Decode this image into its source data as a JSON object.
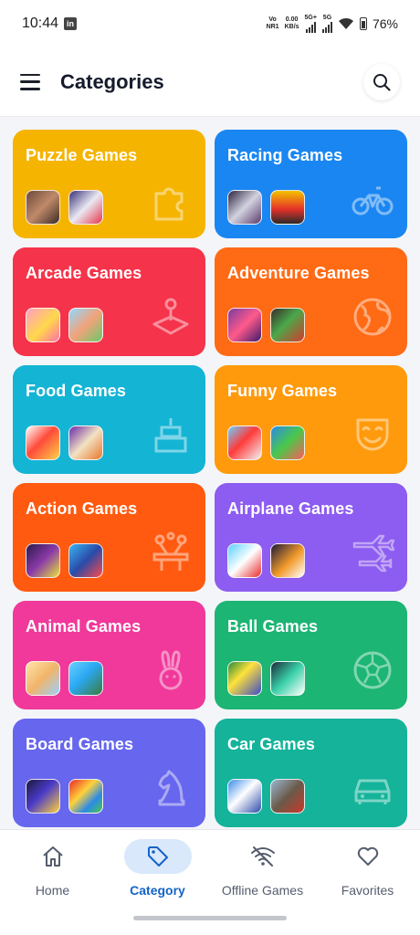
{
  "status_bar": {
    "time": "10:44",
    "notification_badge": "in",
    "network_top": "Vo",
    "network_bottom": "NR1",
    "speed_top": "0.00",
    "speed_bottom": "KB/s",
    "sig1_label": "5G+",
    "sig2_label": "5G",
    "battery": "76%"
  },
  "header": {
    "title": "Categories",
    "menu_icon": "hamburger-menu-icon",
    "search_icon": "search-icon"
  },
  "categories": [
    {
      "title": "Puzzle Games",
      "color": "#f5b400",
      "icon": "puzzle-piece-icon"
    },
    {
      "title": "Racing Games",
      "color": "#1a86f2",
      "icon": "bicycle-icon"
    },
    {
      "title": "Arcade Games",
      "color": "#f5334a",
      "icon": "joystick-icon"
    },
    {
      "title": "Adventure Games",
      "color": "#ff6a14",
      "icon": "globe-icon"
    },
    {
      "title": "Food Games",
      "color": "#14b4d4",
      "icon": "cake-icon"
    },
    {
      "title": "Funny Games",
      "color": "#ff9a0c",
      "icon": "mask-icon"
    },
    {
      "title": "Action Games",
      "color": "#ff5a10",
      "icon": "balloons-icon"
    },
    {
      "title": "Airplane Games",
      "color": "#8d5cf0",
      "icon": "airplanes-icon"
    },
    {
      "title": "Animal Games",
      "color": "#f0399a",
      "icon": "rabbit-icon"
    },
    {
      "title": "Ball Games",
      "color": "#1cb574",
      "icon": "soccer-ball-icon"
    },
    {
      "title": "Board Games",
      "color": "#6666ee",
      "icon": "chess-knight-icon"
    },
    {
      "title": "Car Games",
      "color": "#14b39a",
      "icon": "car-icon"
    }
  ],
  "bottom_nav": [
    {
      "label": "Home",
      "icon": "home-icon",
      "active": false
    },
    {
      "label": "Category",
      "icon": "tag-icon",
      "active": true
    },
    {
      "label": "Offline Games",
      "icon": "wifi-off-icon",
      "active": false
    },
    {
      "label": "Favorites",
      "icon": "heart-icon",
      "active": false
    }
  ]
}
